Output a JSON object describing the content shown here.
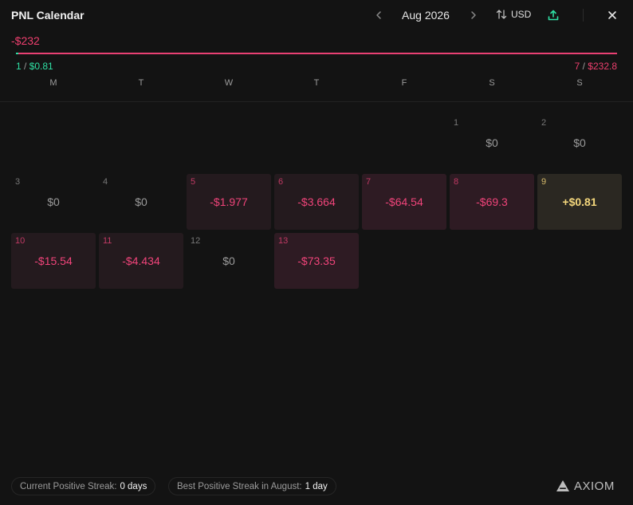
{
  "header": {
    "title": "PNL Calendar",
    "month": "Aug 2026",
    "prev_icon": "chevron-left-icon",
    "next_icon": "chevron-right-icon",
    "currency": "USD",
    "currency_icon": "swap-vertical-icon",
    "upload_icon": "upload-icon",
    "close_icon": "close-icon"
  },
  "summary": {
    "total": "-$232",
    "wins_count": "1",
    "wins_amount": "$0.81",
    "losses_count": "7",
    "losses_amount": "$232.8",
    "win_fraction": 0.0035
  },
  "weekdays": [
    "M",
    "T",
    "W",
    "T",
    "F",
    "S",
    "S"
  ],
  "days": [
    {
      "day": "1",
      "value": "$0",
      "tone": "zero"
    },
    {
      "day": "2",
      "value": "$0",
      "tone": "zero"
    },
    {
      "day": "3",
      "value": "$0",
      "tone": "zero"
    },
    {
      "day": "4",
      "value": "$0",
      "tone": "zero"
    },
    {
      "day": "5",
      "value": "-$1.977",
      "tone": "loss-light"
    },
    {
      "day": "6",
      "value": "-$3.664",
      "tone": "loss-light"
    },
    {
      "day": "7",
      "value": "-$64.54",
      "tone": "loss-strong"
    },
    {
      "day": "8",
      "value": "-$69.3",
      "tone": "loss-strong"
    },
    {
      "day": "9",
      "value": "+$0.81",
      "tone": "gain"
    },
    {
      "day": "10",
      "value": "-$15.54",
      "tone": "loss-light"
    },
    {
      "day": "11",
      "value": "-$4.434",
      "tone": "loss-light"
    },
    {
      "day": "12",
      "value": "$0",
      "tone": "zero"
    },
    {
      "day": "13",
      "value": "-$73.35",
      "tone": "loss-strong"
    }
  ],
  "colors": {
    "background": "#131313",
    "loss": "#ee3f6e",
    "gain": "#2fe0a4",
    "positive_day": "#f4d77c"
  },
  "footer": {
    "current_streak_label": "Current Positive Streak:",
    "current_streak_value": "0 days",
    "best_streak_label": "Best Positive Streak in August:",
    "best_streak_value": "1 day",
    "brand": "AXIOM"
  }
}
